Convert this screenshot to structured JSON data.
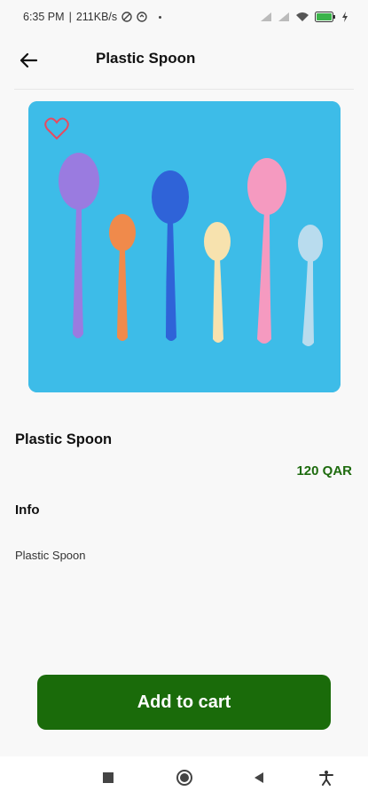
{
  "status_bar": {
    "time": "6:35 PM",
    "network_speed": "211KB/s",
    "battery_level_percent": 100,
    "icons": [
      "data-saver-icon",
      "sync-icon",
      "signal-icon",
      "signal-icon",
      "wifi-icon",
      "battery-icon",
      "charging-icon"
    ]
  },
  "header": {
    "title": "Plastic Spoon",
    "back_icon": "arrow-left-icon"
  },
  "product": {
    "name": "Plastic Spoon",
    "price": "120 QAR",
    "info_heading": "Info",
    "info_text": "Plastic Spoon",
    "favorite_icon": "heart-outline-icon",
    "image_subject": "plastic spoons"
  },
  "actions": {
    "add_to_cart_label": "Add to cart"
  },
  "nav_bar": {
    "icons": [
      "square-icon",
      "circle-icon",
      "triangle-back-icon",
      "accessibility-icon"
    ]
  },
  "colors": {
    "accent": "#1a6b0a",
    "price": "#1e6b0e",
    "image_background": "#3dbce8",
    "favorite": "#e84a5f"
  }
}
